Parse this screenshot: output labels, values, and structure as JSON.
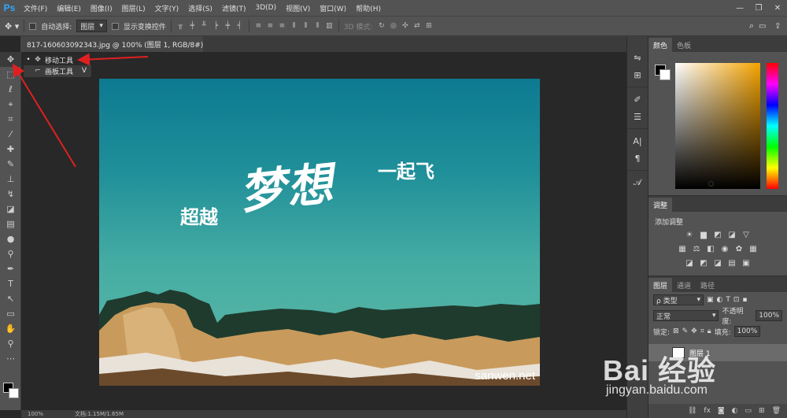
{
  "app": {
    "logo": "Ps",
    "menu": [
      "文件(F)",
      "编辑(E)",
      "图像(I)",
      "图层(L)",
      "文字(Y)",
      "选择(S)",
      "滤镜(T)",
      "3D(D)",
      "视图(V)",
      "窗口(W)",
      "帮助(H)"
    ]
  },
  "options": {
    "auto_select_label": "自动选择:",
    "auto_select_target": "图层",
    "show_transform_label": "显示变换控件",
    "mode_3d_label": "3D 模式:"
  },
  "document": {
    "tab_title": "817-160603092343.jpg @ 100% (图层 1, RGB/8#) *"
  },
  "flyout": {
    "items": [
      {
        "label": "移动工具",
        "key": "V"
      },
      {
        "label": "画板工具",
        "key": "V"
      }
    ]
  },
  "artwork": {
    "main_text": "梦想",
    "left_text": "超越",
    "right_text": "一起飞",
    "watermark": "sanwen.net"
  },
  "panels": {
    "color_tabs": [
      "颜色",
      "色板"
    ],
    "adjust_title": "调整",
    "adjust_label": "添加调整",
    "layer_tabs": [
      "图层",
      "通道",
      "路径"
    ],
    "filter_kind": "ρ 类型",
    "blend_mode": "正常",
    "opacity_label": "不透明度:",
    "opacity_value": "100%",
    "lock_label": "锁定:",
    "fill_label": "填充:",
    "fill_value": "100%",
    "layer_name": "图层 1"
  },
  "status": {
    "zoom": "100%",
    "doc_size": "文档:1.15M/1.65M"
  },
  "overlay": {
    "baidu_main": "Bai 经验",
    "baidu_url": "jingyan.baidu.com"
  },
  "colors": {
    "ps_blue": "#31a8ff",
    "annotation_red": "#e02020"
  }
}
